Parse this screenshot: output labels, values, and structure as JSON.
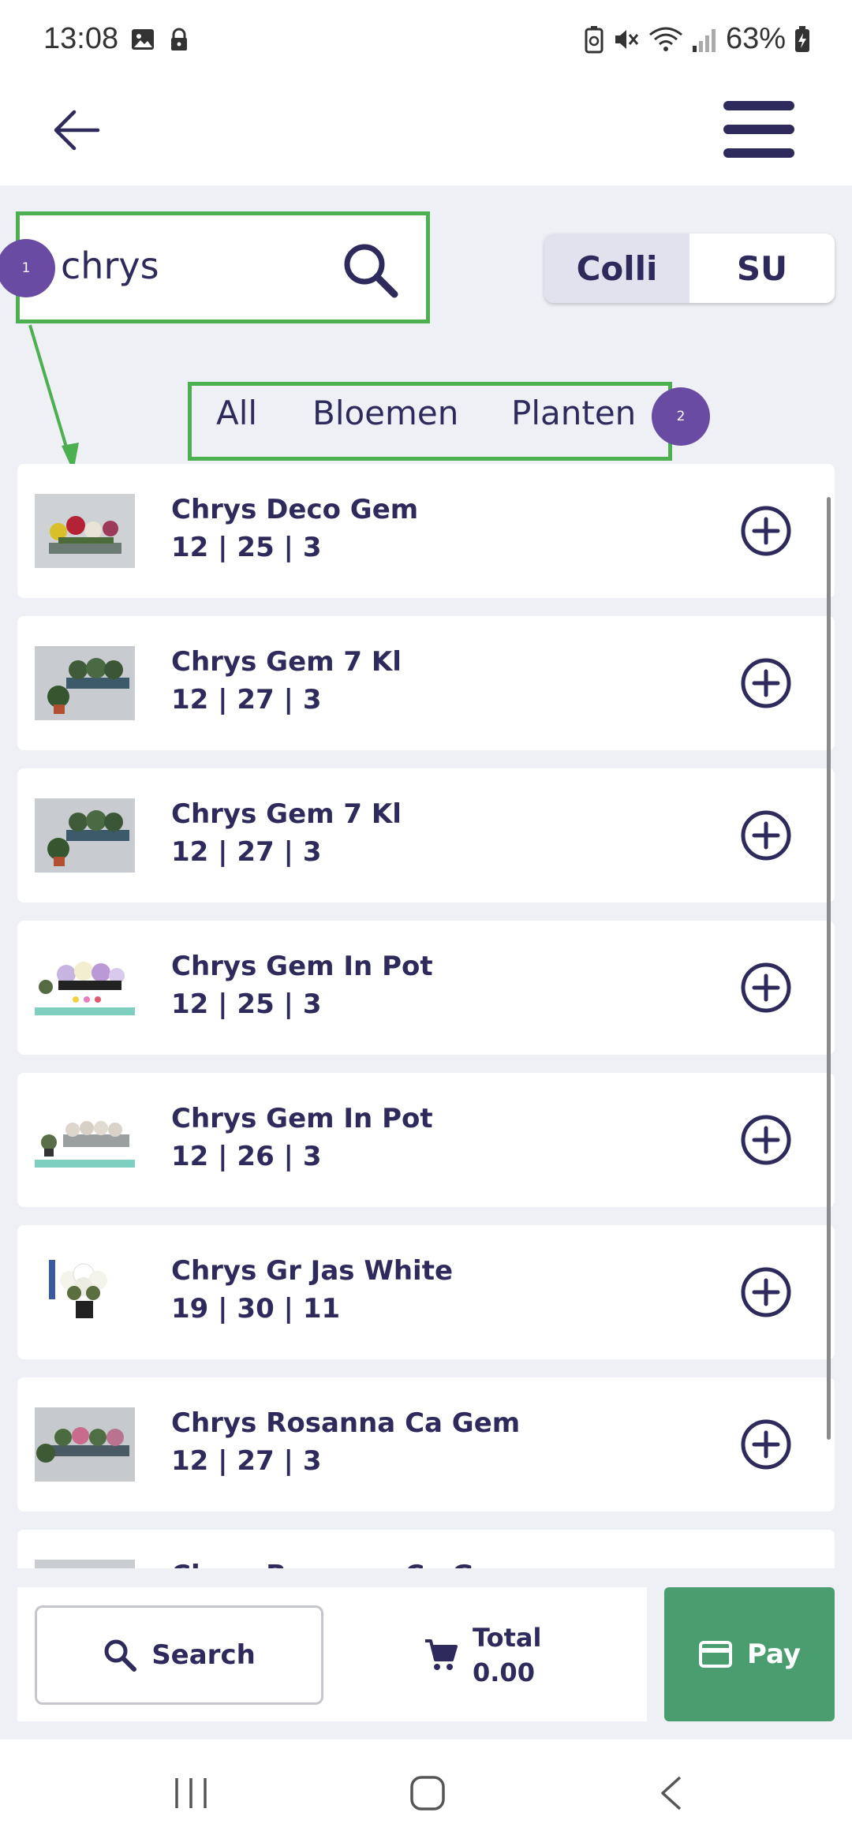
{
  "status_bar": {
    "time": "13:08",
    "battery": "63%"
  },
  "app_bar": {
    "back_icon": "arrow-left-icon",
    "menu_icon": "hamburger-menu-icon"
  },
  "search": {
    "value": "chrys",
    "icon": "search-icon"
  },
  "annotations": {
    "badge_1": "1",
    "badge_2": "2",
    "highlight_color": "#4caf50",
    "badge_color": "#6a4ba3"
  },
  "unit_toggle": {
    "options": [
      "Colli",
      "SU"
    ],
    "selected": "Colli"
  },
  "categories": [
    "All",
    "Bloemen",
    "Planten"
  ],
  "products": [
    {
      "name": "Chrys Deco Gem",
      "numbers": "12 | 25 | 3"
    },
    {
      "name": "Chrys Gem 7 Kl",
      "numbers": "12 | 27 | 3"
    },
    {
      "name": "Chrys Gem 7 Kl",
      "numbers": "12 | 27 | 3"
    },
    {
      "name": "Chrys Gem In Pot",
      "numbers": "12 | 25 | 3"
    },
    {
      "name": "Chrys Gem In Pot",
      "numbers": "12 | 26 | 3"
    },
    {
      "name": "Chrys Gr Jas White",
      "numbers": "19 | 30 | 11"
    },
    {
      "name": "Chrys Rosanna Ca Gem",
      "numbers": "12 | 27 | 3"
    },
    {
      "name": "Chrys Rosanna Ca Gem",
      "numbers": ""
    }
  ],
  "bottom_bar": {
    "search_label": "Search",
    "total_label": "Total",
    "total_value": "0.00",
    "pay_label": "Pay"
  },
  "colors": {
    "primary": "#2e2b5c",
    "pay": "#4a9d6f",
    "background": "#eef0f6"
  }
}
